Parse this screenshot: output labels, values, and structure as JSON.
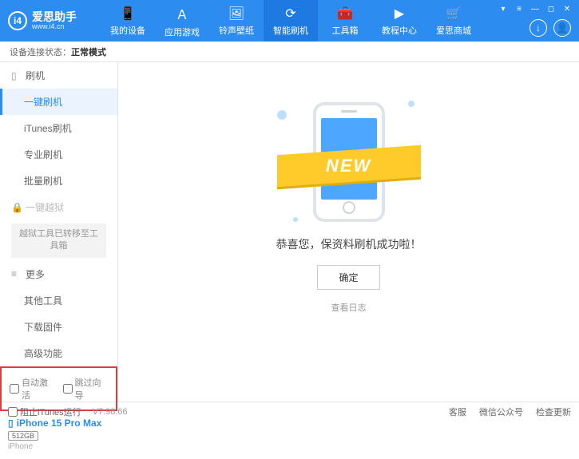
{
  "app": {
    "title": "爱思助手",
    "subtitle": "www.i4.cn"
  },
  "nav": {
    "items": [
      {
        "label": "我的设备",
        "icon": "📱"
      },
      {
        "label": "应用游戏",
        "icon": "Ａ"
      },
      {
        "label": "铃声壁纸",
        "icon": "🖼"
      },
      {
        "label": "智能刷机",
        "icon": "⟳"
      },
      {
        "label": "工具箱",
        "icon": "🧰"
      },
      {
        "label": "教程中心",
        "icon": "▶"
      },
      {
        "label": "爱思商城",
        "icon": "🛒"
      }
    ],
    "activeIndex": 3
  },
  "status": {
    "prefix": "设备连接状态：",
    "mode": "正常模式"
  },
  "sidebar": {
    "group_flash": "刷机",
    "items_flash": [
      "一键刷机",
      "iTunes刷机",
      "专业刷机",
      "批量刷机"
    ],
    "activeFlash": 0,
    "group_jailbreak": "一键越狱",
    "jailbreak_note": "越狱工具已转移至工具箱",
    "group_more": "更多",
    "items_more": [
      "其他工具",
      "下载固件",
      "高级功能"
    ],
    "check_auto": "自动激活",
    "check_skip": "跳过向导"
  },
  "device": {
    "name": "iPhone 15 Pro Max",
    "storage": "512GB",
    "os": "iPhone"
  },
  "main": {
    "badge": "NEW",
    "message": "恭喜您，保资料刷机成功啦！",
    "ok": "确定",
    "log": "查看日志"
  },
  "footer": {
    "block_itunes": "阻止iTunes运行",
    "version": "V7.98.66",
    "links": [
      "客服",
      "微信公众号",
      "检查更新"
    ]
  }
}
